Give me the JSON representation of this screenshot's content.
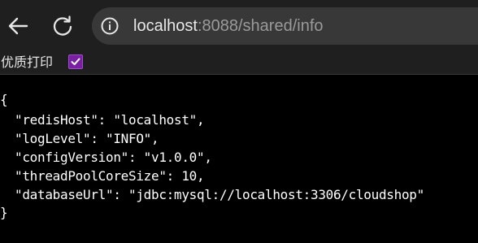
{
  "browser": {
    "back_icon": "arrow-left-icon",
    "reload_icon": "reload-icon",
    "site_info_icon": "info-circle-icon",
    "url_host": "localhost",
    "url_path": ":8088/shared/info"
  },
  "pretty_print": {
    "label": "优质打印",
    "checked": true,
    "accent": "#7b1fa2"
  },
  "json_lines": [
    "{",
    "\"redisHost\": \"localhost\",",
    "\"logLevel\": \"INFO\",",
    "\"configVersion\": \"v1.0.0\",",
    "\"threadPoolCoreSize\": 10,",
    "\"databaseUrl\": \"jdbc:mysql://localhost:3306/cloudshop\"",
    "}"
  ]
}
